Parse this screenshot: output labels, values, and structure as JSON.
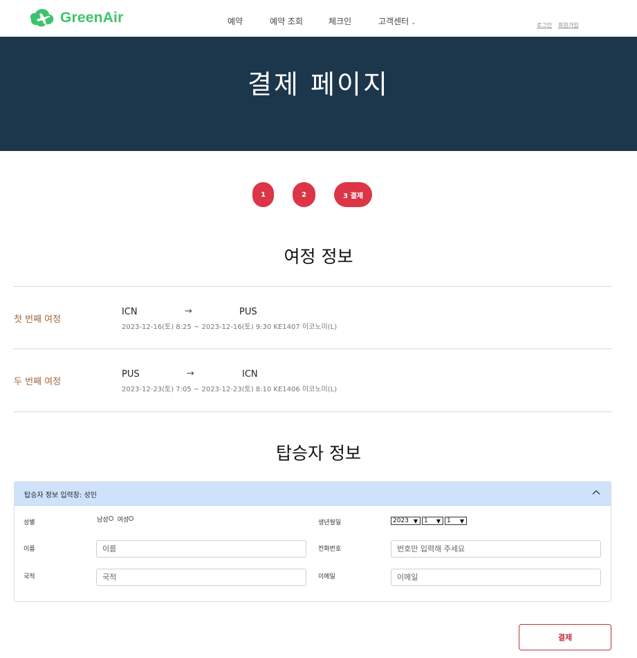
{
  "header": {
    "brand": "GreenAir",
    "nav": [
      "예약",
      "예약 조회",
      "체크인",
      "고객센터"
    ],
    "auth": {
      "login": "로그인",
      "signup": "회원가입"
    }
  },
  "banner": {
    "title": "결제 페이지"
  },
  "steps": [
    {
      "label": "1"
    },
    {
      "label": "2"
    },
    {
      "label": "3 결제",
      "active": true
    }
  ],
  "itinerary": {
    "title": "여정 정보",
    "trips": [
      {
        "label": "첫 번째 여정",
        "from": "ICN",
        "arrow": "→",
        "to": "PUS",
        "detail": "2023-12-16(토)   8:25   ~   2023-12-16(토)   9:30   KE1407   이코노미(L)"
      },
      {
        "label": "두 번째 여정",
        "from": "PUS",
        "arrow": "→",
        "to": "ICN",
        "detail": "2023-12-23(토)   7:05   ~   2023-12-23(토)   8:10   KE1406   이코노미(L)"
      }
    ]
  },
  "passenger": {
    "title": "탑승자 정보",
    "panel_title": "탑승자 정보 입력창: 성인",
    "gender_label": "성별",
    "gender_options": [
      "남성",
      "여성"
    ],
    "name_label": "이름",
    "name_placeholder": "이름",
    "nationality_label": "국적",
    "nationality_placeholder": "국적",
    "birth_label": "생년월일",
    "birth_year": "2023",
    "birth_month": "1",
    "birth_day": "1",
    "phone_label": "전화번호",
    "phone_placeholder": "번호만 입력해 주세요",
    "email_label": "이메일",
    "email_placeholder": "이메일"
  },
  "pay_button": "결제",
  "colors": {
    "brand_green": "#3cc46a",
    "banner_bg": "#1c364c",
    "step_red": "#dc3545",
    "trip_label": "#a5683a",
    "panel_head": "#cfe2fb"
  }
}
